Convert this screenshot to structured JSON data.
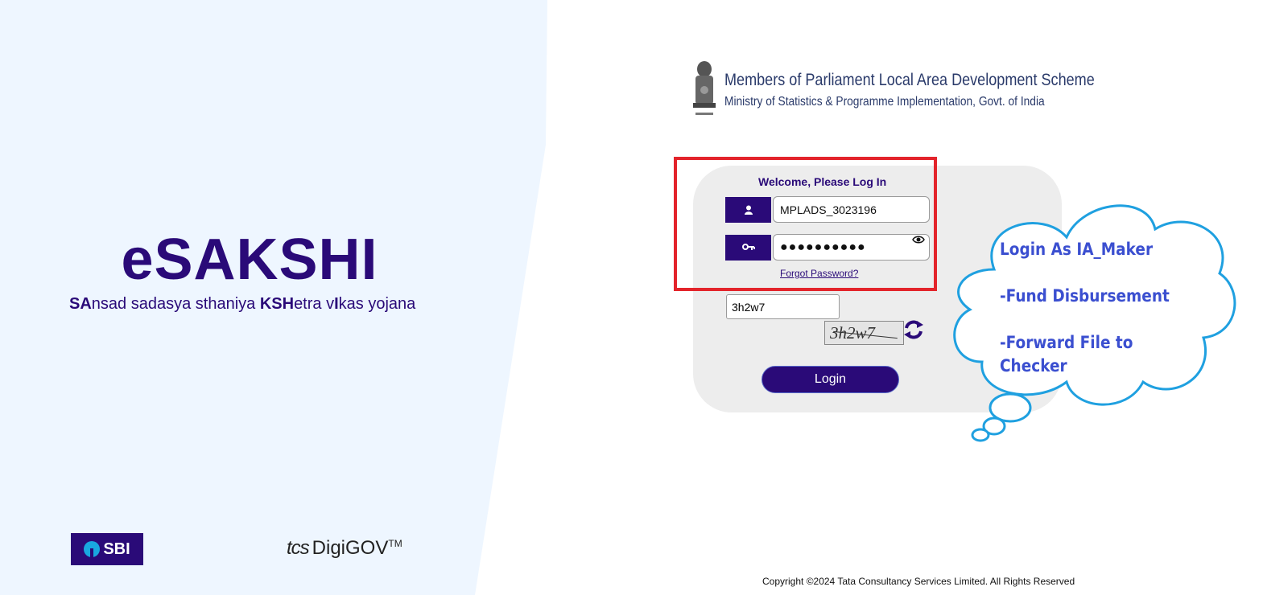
{
  "brand": {
    "title": "eSAKSHI",
    "subtitle_parts": [
      {
        "text": "SA",
        "bold": true
      },
      {
        "text": "nsad sadasya sthaniya ",
        "bold": false
      },
      {
        "text": "KSH",
        "bold": true
      },
      {
        "text": "etra v",
        "bold": false
      },
      {
        "text": "I",
        "bold": true
      },
      {
        "text": "kas yojana",
        "bold": false
      }
    ]
  },
  "partners": {
    "sbi": "SBI",
    "tcs": "tcs",
    "digigov": "DigiGOV",
    "tm": "TM"
  },
  "scheme": {
    "title": "Members of Parliament Local Area Development Scheme",
    "subtitle": "Ministry of Statistics & Programme Implementation, Govt. of India",
    "emblem_icon": "national-emblem-icon"
  },
  "login": {
    "welcome": "Welcome, Please Log In",
    "username_value": "MPLADS_3023196",
    "password_mask": "●●●●●●●●●●",
    "forgot_label": "Forgot Password?",
    "captcha_value": "3h2w7",
    "captcha_image_text": "3h2w7",
    "button_label": "Login",
    "icons": [
      "user-icon",
      "key-icon",
      "eye-icon",
      "refresh-icon"
    ]
  },
  "annotation": {
    "line1": "Login As IA_Maker",
    "line2": "-Fund Disbursement",
    "line3a": "-Forward File to",
    "line3b": "Checker"
  },
  "footer": {
    "copyright": "Copyright ©2024 Tata Consultancy Services Limited. All Rights Reserved"
  },
  "colors": {
    "brand_purple": "#2a0a78",
    "highlight_red": "#e3242b",
    "cloud_blue": "#1fa0e0",
    "annotation_text": "#3b4fd0",
    "left_panel_bg": "#eef6ff"
  }
}
